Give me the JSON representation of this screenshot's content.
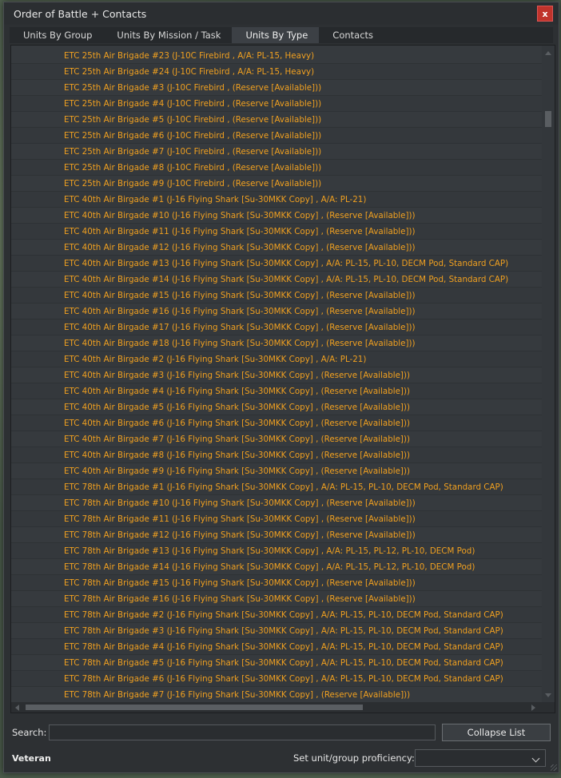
{
  "window": {
    "title": "Order of Battle + Contacts",
    "close_label": "x"
  },
  "tabs": [
    {
      "label": "Units By Group"
    },
    {
      "label": "Units By Mission / Task"
    },
    {
      "label": "Units By Type"
    },
    {
      "label": "Contacts"
    }
  ],
  "active_tab": "Units By Type",
  "units": [
    "ETC 25th Air Brigade #23 (J-10C Firebird , A/A: PL-15, Heavy)",
    "ETC 25th Air Brigade #24 (J-10C Firebird , A/A: PL-15, Heavy)",
    "ETC 25th Air Brigade #3 (J-10C Firebird , (Reserve [Available]))",
    "ETC 25th Air Brigade #4 (J-10C Firebird , (Reserve [Available]))",
    "ETC 25th Air Brigade #5 (J-10C Firebird , (Reserve [Available]))",
    "ETC 25th Air Brigade #6 (J-10C Firebird , (Reserve [Available]))",
    "ETC 25th Air Brigade #7 (J-10C Firebird , (Reserve [Available]))",
    "ETC 25th Air Brigade #8 (J-10C Firebird , (Reserve [Available]))",
    "ETC 25th Air Brigade #9 (J-10C Firebird , (Reserve [Available]))",
    "ETC 40th Air Birgade #1 (J-16 Flying Shark [Su-30MKK Copy] , A/A: PL-21)",
    "ETC 40th Air Birgade #10 (J-16 Flying Shark [Su-30MKK Copy] , (Reserve [Available]))",
    "ETC 40th Air Birgade #11 (J-16 Flying Shark [Su-30MKK Copy] , (Reserve [Available]))",
    "ETC 40th Air Birgade #12 (J-16 Flying Shark [Su-30MKK Copy] , (Reserve [Available]))",
    "ETC 40th Air Birgade #13 (J-16 Flying Shark [Su-30MKK Copy] , A/A: PL-15, PL-10, DECM Pod, Standard CAP)",
    "ETC 40th Air Birgade #14 (J-16 Flying Shark [Su-30MKK Copy] , A/A: PL-15, PL-10, DECM Pod, Standard CAP)",
    "ETC 40th Air Birgade #15 (J-16 Flying Shark [Su-30MKK Copy] , (Reserve [Available]))",
    "ETC 40th Air Birgade #16 (J-16 Flying Shark [Su-30MKK Copy] , (Reserve [Available]))",
    "ETC 40th Air Birgade #17 (J-16 Flying Shark [Su-30MKK Copy] , (Reserve [Available]))",
    "ETC 40th Air Birgade #18 (J-16 Flying Shark [Su-30MKK Copy] , (Reserve [Available]))",
    "ETC 40th Air Birgade #2 (J-16 Flying Shark [Su-30MKK Copy] , A/A: PL-21)",
    "ETC 40th Air Birgade #3 (J-16 Flying Shark [Su-30MKK Copy] , (Reserve [Available]))",
    "ETC 40th Air Birgade #4 (J-16 Flying Shark [Su-30MKK Copy] , (Reserve [Available]))",
    "ETC 40th Air Birgade #5 (J-16 Flying Shark [Su-30MKK Copy] , (Reserve [Available]))",
    "ETC 40th Air Birgade #6 (J-16 Flying Shark [Su-30MKK Copy] , (Reserve [Available]))",
    "ETC 40th Air Birgade #7 (J-16 Flying Shark [Su-30MKK Copy] , (Reserve [Available]))",
    "ETC 40th Air Birgade #8 (J-16 Flying Shark [Su-30MKK Copy] , (Reserve [Available]))",
    "ETC 40th Air Birgade #9 (J-16 Flying Shark [Su-30MKK Copy] , (Reserve [Available]))",
    "ETC 78th Air Brigade #1 (J-16 Flying Shark [Su-30MKK Copy] , A/A: PL-15, PL-10, DECM Pod, Standard CAP)",
    "ETC 78th Air Brigade #10 (J-16 Flying Shark [Su-30MKK Copy] , (Reserve [Available]))",
    "ETC 78th Air Brigade #11 (J-16 Flying Shark [Su-30MKK Copy] , (Reserve [Available]))",
    "ETC 78th Air Brigade #12 (J-16 Flying Shark [Su-30MKK Copy] , (Reserve [Available]))",
    "ETC 78th Air Brigade #13 (J-16 Flying Shark [Su-30MKK Copy] , A/A: PL-15, PL-12, PL-10, DECM Pod)",
    "ETC 78th Air Brigade #14 (J-16 Flying Shark [Su-30MKK Copy] , A/A: PL-15, PL-12, PL-10, DECM Pod)",
    "ETC 78th Air Brigade #15 (J-16 Flying Shark [Su-30MKK Copy] , (Reserve [Available]))",
    "ETC 78th Air Brigade #16 (J-16 Flying Shark [Su-30MKK Copy] , (Reserve [Available]))",
    "ETC 78th Air Brigade #2 (J-16 Flying Shark [Su-30MKK Copy] , A/A: PL-15, PL-10, DECM Pod, Standard CAP)",
    "ETC 78th Air Brigade #3 (J-16 Flying Shark [Su-30MKK Copy] , A/A: PL-15, PL-10, DECM Pod, Standard CAP)",
    "ETC 78th Air Brigade #4 (J-16 Flying Shark [Su-30MKK Copy] , A/A: PL-15, PL-10, DECM Pod, Standard CAP)",
    "ETC 78th Air Brigade #5 (J-16 Flying Shark [Su-30MKK Copy] , A/A: PL-15, PL-10, DECM Pod, Standard CAP)",
    "ETC 78th Air Brigade #6 (J-16 Flying Shark [Su-30MKK Copy] , A/A: PL-15, PL-10, DECM Pod, Standard CAP)",
    "ETC 78th Air Brigade #7 (J-16 Flying Shark [Su-30MKK Copy] , (Reserve [Available]))"
  ],
  "search": {
    "label": "Search:",
    "value": "",
    "placeholder": ""
  },
  "collapse_button_label": "Collapse List",
  "proficiency": {
    "current_unit_proficiency": "Veteran",
    "label": "Set unit/group proficiency:",
    "selected_value": ""
  },
  "colors": {
    "unit_text": "#f0a020",
    "close_button": "#c0332b",
    "window_bg": "#2d3033",
    "list_bg": "#363a3e"
  },
  "icons": [
    "close-icon",
    "chevron-down-icon",
    "scroll-up-arrow-icon",
    "scroll-down-arrow-icon",
    "scroll-left-arrow-icon",
    "scroll-right-arrow-icon",
    "resize-grip-icon"
  ]
}
